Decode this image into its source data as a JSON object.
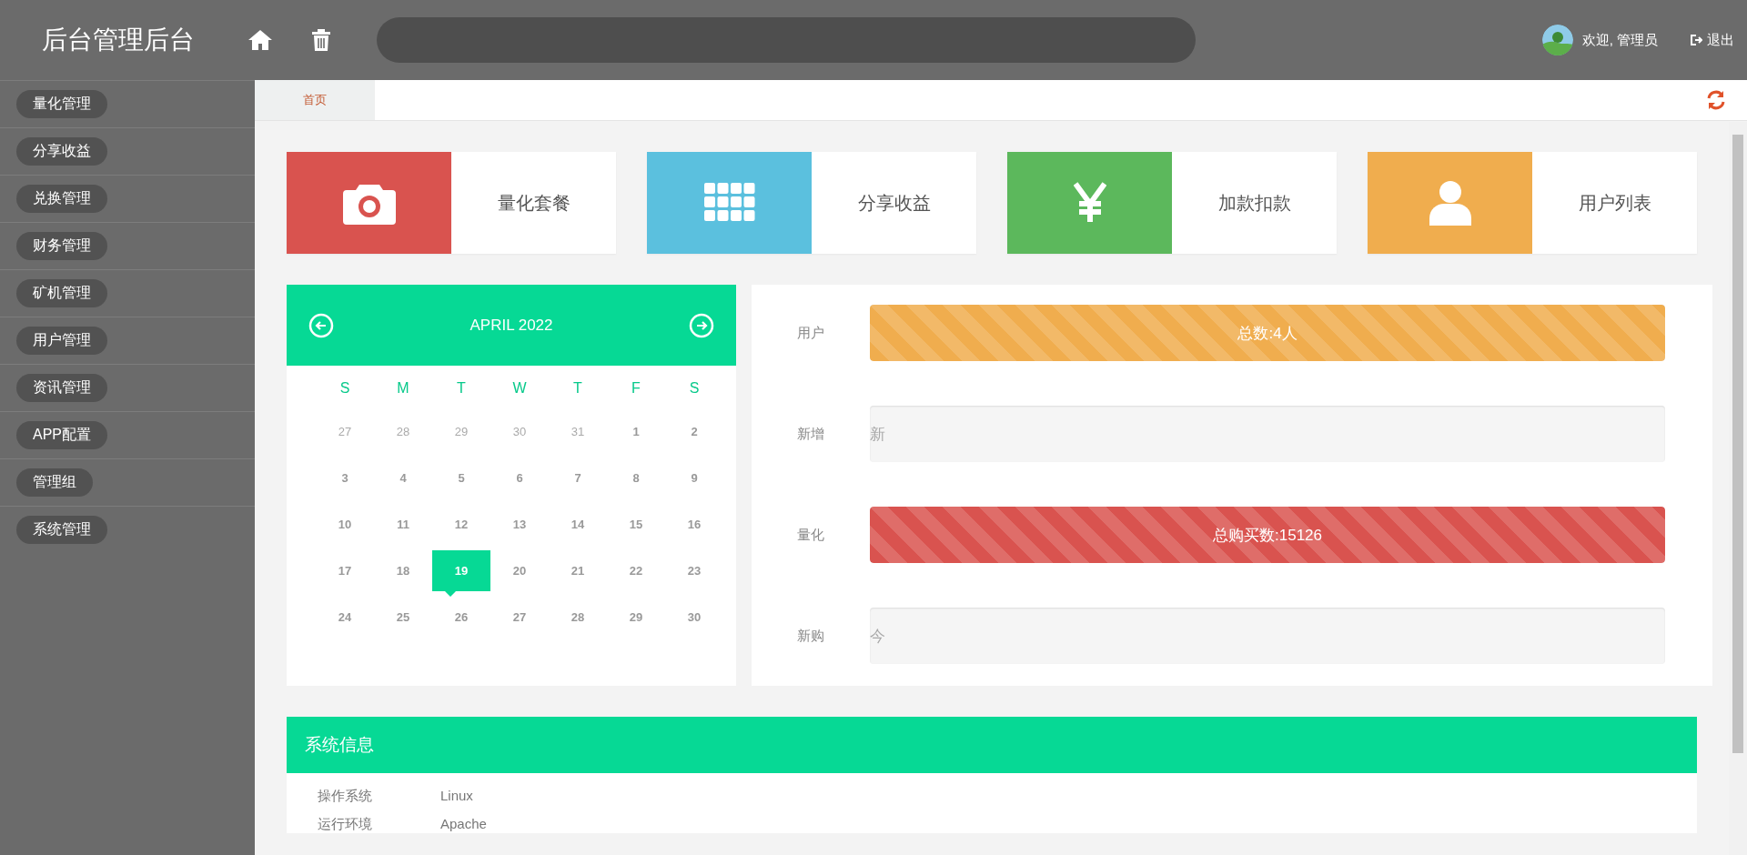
{
  "header": {
    "title": "后台管理后台",
    "welcome": "欢迎, 管理员",
    "logout": "退出"
  },
  "sidebar": {
    "items": [
      {
        "label": "量化管理"
      },
      {
        "label": "分享收益"
      },
      {
        "label": "兑换管理"
      },
      {
        "label": "财务管理"
      },
      {
        "label": "矿机管理"
      },
      {
        "label": "用户管理"
      },
      {
        "label": "资讯管理"
      },
      {
        "label": "APP配置"
      },
      {
        "label": "管理组"
      },
      {
        "label": "系统管理"
      }
    ]
  },
  "tabs": [
    {
      "label": "首页",
      "selected": true
    }
  ],
  "cards": [
    {
      "kind": "camera",
      "label": "量化套餐",
      "color": "#d9534f"
    },
    {
      "kind": "grid",
      "label": "分享收益",
      "color": "#5bc0de"
    },
    {
      "kind": "yen",
      "label": "加款扣款",
      "color": "#5cb85c"
    },
    {
      "kind": "user",
      "label": "用户列表",
      "color": "#f0ad4e"
    }
  ],
  "calendar": {
    "title": "APRIL 2022",
    "weekdays": [
      "S",
      "M",
      "T",
      "W",
      "T",
      "F",
      "S"
    ],
    "days": [
      {
        "label": "27",
        "muted": true,
        "selected": false
      },
      {
        "label": "28",
        "muted": true,
        "selected": false
      },
      {
        "label": "29",
        "muted": true,
        "selected": false
      },
      {
        "label": "30",
        "muted": true,
        "selected": false
      },
      {
        "label": "31",
        "muted": true,
        "selected": false
      },
      {
        "label": "1",
        "muted": false,
        "selected": false
      },
      {
        "label": "2",
        "muted": false,
        "selected": false
      },
      {
        "label": "3",
        "muted": false,
        "selected": false
      },
      {
        "label": "4",
        "muted": false,
        "selected": false
      },
      {
        "label": "5",
        "muted": false,
        "selected": false
      },
      {
        "label": "6",
        "muted": false,
        "selected": false
      },
      {
        "label": "7",
        "muted": false,
        "selected": false
      },
      {
        "label": "8",
        "muted": false,
        "selected": false
      },
      {
        "label": "9",
        "muted": false,
        "selected": false
      },
      {
        "label": "10",
        "muted": false,
        "selected": false
      },
      {
        "label": "11",
        "muted": false,
        "selected": false
      },
      {
        "label": "12",
        "muted": false,
        "selected": false
      },
      {
        "label": "13",
        "muted": false,
        "selected": false
      },
      {
        "label": "14",
        "muted": false,
        "selected": false
      },
      {
        "label": "15",
        "muted": false,
        "selected": false
      },
      {
        "label": "16",
        "muted": false,
        "selected": false
      },
      {
        "label": "17",
        "muted": false,
        "selected": false
      },
      {
        "label": "18",
        "muted": false,
        "selected": false
      },
      {
        "label": "19",
        "muted": false,
        "selected": true
      },
      {
        "label": "20",
        "muted": false,
        "selected": false
      },
      {
        "label": "21",
        "muted": false,
        "selected": false
      },
      {
        "label": "22",
        "muted": false,
        "selected": false
      },
      {
        "label": "23",
        "muted": false,
        "selected": false
      },
      {
        "label": "24",
        "muted": false,
        "selected": false
      },
      {
        "label": "25",
        "muted": false,
        "selected": false
      },
      {
        "label": "26",
        "muted": false,
        "selected": false
      },
      {
        "label": "27",
        "muted": false,
        "selected": false
      },
      {
        "label": "28",
        "muted": false,
        "selected": false
      },
      {
        "label": "29",
        "muted": false,
        "selected": false
      },
      {
        "label": "30",
        "muted": false,
        "selected": false
      }
    ]
  },
  "stats": [
    {
      "label": "用户",
      "text": "总数:4人",
      "level": 1,
      "color": "#f0ad4e"
    },
    {
      "label": "新增",
      "text": "新",
      "level": 0
    },
    {
      "label": "量化",
      "text": "总购买数:15126",
      "level": 1,
      "color": "#d9534f"
    },
    {
      "label": "新购",
      "text": "今",
      "level": 0
    }
  ],
  "system_info": {
    "title": "系统信息",
    "rows": [
      {
        "key": "操作系统",
        "value": "Linux"
      },
      {
        "key": "运行环境",
        "value": "Apache"
      }
    ]
  }
}
